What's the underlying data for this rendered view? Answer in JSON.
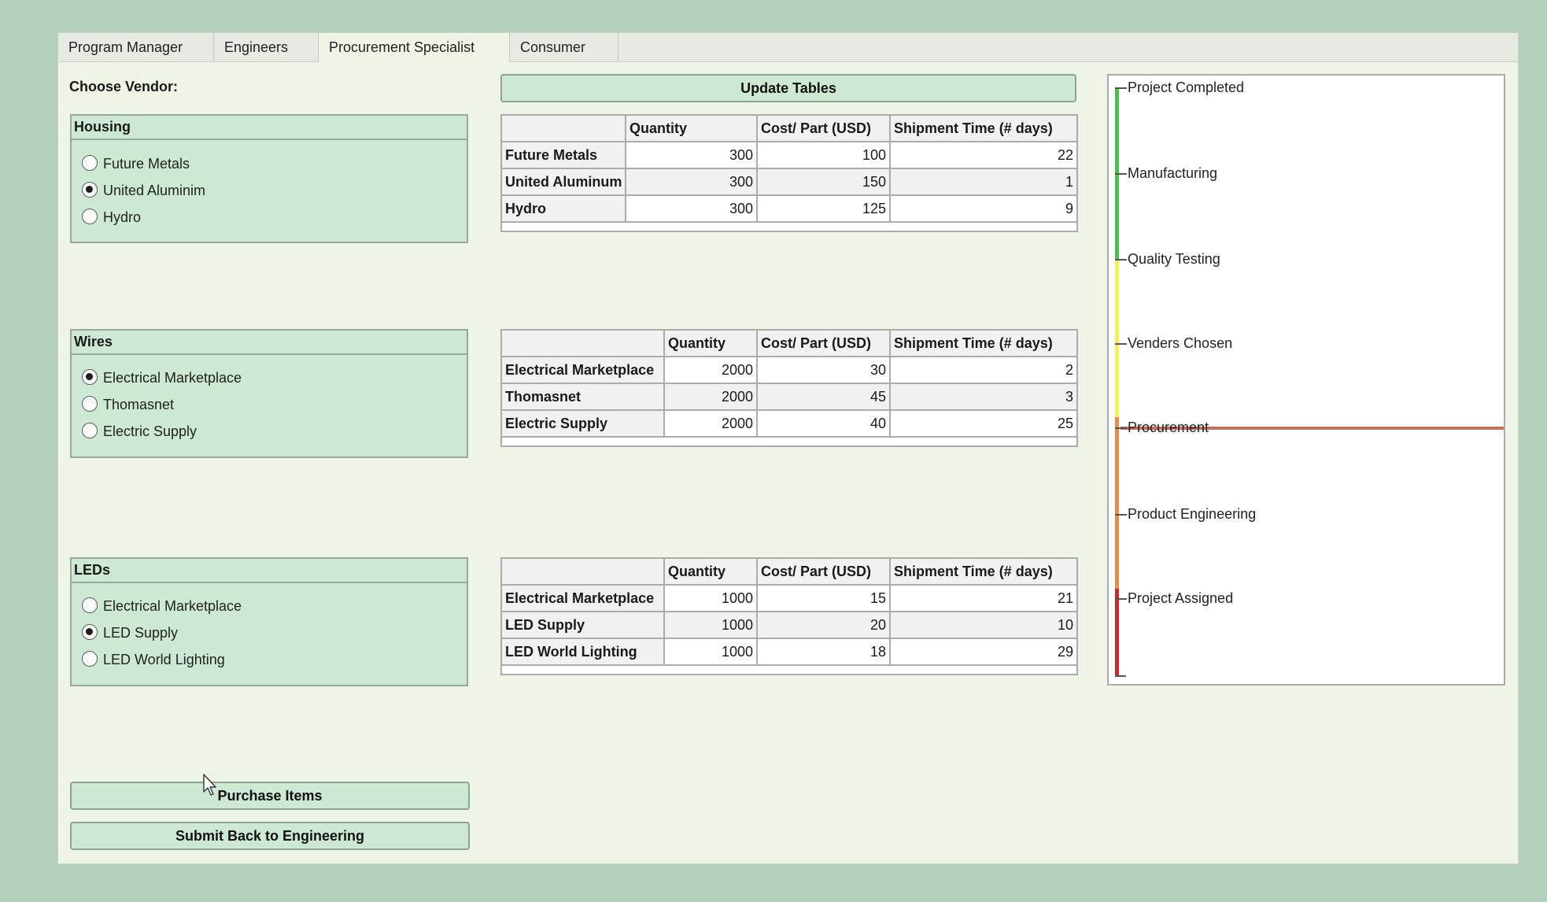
{
  "tabs": [
    {
      "label": "Program Manager",
      "active": false
    },
    {
      "label": "Engineers",
      "active": false
    },
    {
      "label": "Procurement Specialist",
      "active": true
    },
    {
      "label": "Consumer",
      "active": false
    }
  ],
  "choose_vendor_label": "Choose Vendor:",
  "update_button": "Update Tables",
  "purchase_button": "Purchase Items",
  "submit_button": "Submit Back to Engineering",
  "groups": [
    {
      "title": "Housing",
      "options": [
        {
          "label": "Future Metals",
          "selected": false
        },
        {
          "label": "United Aluminim",
          "selected": true
        },
        {
          "label": "Hydro",
          "selected": false
        }
      ]
    },
    {
      "title": "Wires",
      "options": [
        {
          "label": "Electrical Marketplace",
          "selected": true
        },
        {
          "label": "Thomasnet",
          "selected": false
        },
        {
          "label": "Electric Supply",
          "selected": false
        }
      ]
    },
    {
      "title": "LEDs",
      "options": [
        {
          "label": "Electrical Marketplace",
          "selected": false
        },
        {
          "label": "LED Supply",
          "selected": true
        },
        {
          "label": "LED World Lighting",
          "selected": false
        }
      ]
    }
  ],
  "table_headers": [
    "",
    "Quantity",
    "Cost/ Part (USD)",
    "Shipment Time (# days)"
  ],
  "tables": [
    {
      "rows": [
        {
          "vendor": "Future Metals",
          "quantity": "300",
          "cost": "100",
          "shipment": "22"
        },
        {
          "vendor": "United Aluminum",
          "quantity": "300",
          "cost": "150",
          "shipment": "1"
        },
        {
          "vendor": "Hydro",
          "quantity": "300",
          "cost": "125",
          "shipment": "9"
        }
      ]
    },
    {
      "rows": [
        {
          "vendor": "Electrical Marketplace",
          "quantity": "2000",
          "cost": "30",
          "shipment": "2"
        },
        {
          "vendor": "Thomasnet",
          "quantity": "2000",
          "cost": "45",
          "shipment": "3"
        },
        {
          "vendor": "Electric Supply",
          "quantity": "2000",
          "cost": "40",
          "shipment": "25"
        }
      ]
    },
    {
      "rows": [
        {
          "vendor": "Electrical Marketplace",
          "quantity": "1000",
          "cost": "15",
          "shipment": "21"
        },
        {
          "vendor": "LED Supply",
          "quantity": "1000",
          "cost": "20",
          "shipment": "10"
        },
        {
          "vendor": "LED World Lighting",
          "quantity": "1000",
          "cost": "18",
          "shipment": "29"
        }
      ]
    }
  ],
  "stages": [
    "Project Completed",
    "Manufacturing",
    "Quality Testing",
    "Venders Chosen",
    "Procurement",
    "Product Engineering",
    "Project Assigned"
  ],
  "current_stage": "Procurement",
  "colors": {
    "background": "#b4d0bc",
    "panel": "#eef5e7",
    "group_fill": "#cde8d3",
    "progress_green": "#4cc04a",
    "progress_yellow": "#f5f05a",
    "progress_orange": "#e88a4a",
    "progress_red": "#c62a2a",
    "current_marker": "#c56e5e"
  }
}
